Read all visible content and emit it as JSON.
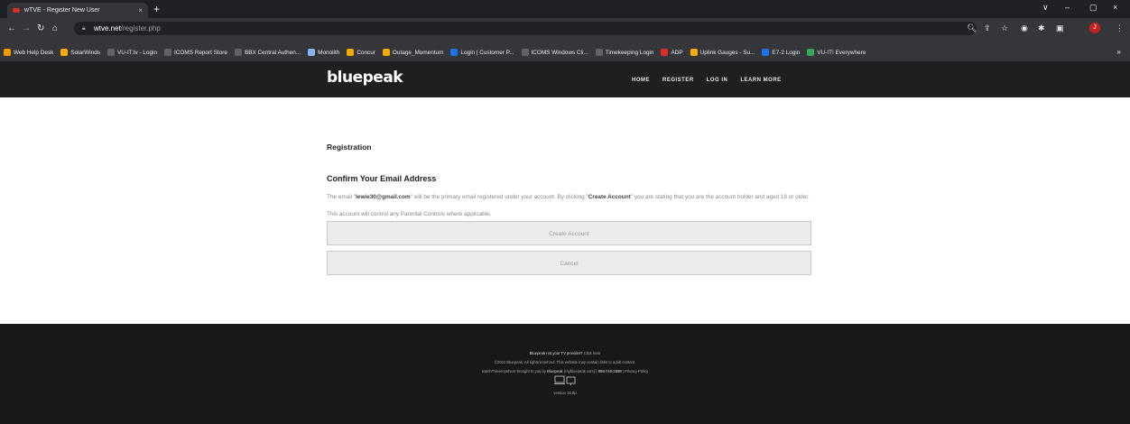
{
  "browser": {
    "tab_title": "wTVE - Register New User",
    "tab_close": "×",
    "new_tab": "+",
    "window_controls": [
      "∨",
      "–",
      "▢",
      "×"
    ],
    "url_host": "wtve.net",
    "url_path": "/register.php",
    "profile_initial": "J",
    "bookmarks": [
      {
        "label": "Web Help Desk",
        "color": "#f29900"
      },
      {
        "label": "SolarWinds",
        "color": "#f9ab00"
      },
      {
        "label": "VU-IT.tv - Login",
        "color": "#5f6368"
      },
      {
        "label": "ICOMS Report Store",
        "color": "#5f6368"
      },
      {
        "label": "BBX Central Authen...",
        "color": "#5f6368"
      },
      {
        "label": "Monolith",
        "color": "#8ab4f8"
      },
      {
        "label": "Concur",
        "color": "#f9ab00"
      },
      {
        "label": "Outage_Momentum",
        "color": "#f9ab00"
      },
      {
        "label": "Login | Customer P...",
        "color": "#1a73e8"
      },
      {
        "label": "ICOMS Windows Cli...",
        "color": "#5f6368"
      },
      {
        "label": "Timekeeping Login",
        "color": "#5f6368"
      },
      {
        "label": "ADP",
        "color": "#d93025"
      },
      {
        "label": "Uplink Gauges - Su...",
        "color": "#f9ab00"
      },
      {
        "label": "E7-2 Login",
        "color": "#1a73e8"
      },
      {
        "label": "VU-IT! Everywhere",
        "color": "#34a853"
      }
    ],
    "bookmarks_more": "»"
  },
  "site": {
    "logo": "bluepeak",
    "nav": [
      "HOME",
      "REGISTER",
      "LOG IN",
      "LEARN MORE"
    ]
  },
  "main": {
    "section_title": "Registration",
    "heading": "Confirm Your Email Address",
    "desc_prefix": "The email \"",
    "email": "lewie30@gmail.com",
    "desc_mid": "\" will be the primary email registered under your account. By clicking \"",
    "create_ref": "Create Account",
    "desc_suffix": "\" you are stating that you are the account holder and aged 18 or older. This account will control any Parental Controls where applicable.",
    "create_button": "Create Account",
    "cancel_button": "Cancel"
  },
  "footer": {
    "line1": "Bluepeak not your TV provider?",
    "line1_link": "Click here",
    "line2": "©2022 Bluepeak. All rights reserved. This website may contain links to adult content.",
    "line3_a": "watchTVeverywhere brought to you by",
    "line3_brand": "Bluepeak",
    "line3_url": "(mybluepeak.com)",
    "line3_phone": "888-740-2888",
    "line3_privacy": "Privacy Policy",
    "version": "version 16.5p"
  }
}
